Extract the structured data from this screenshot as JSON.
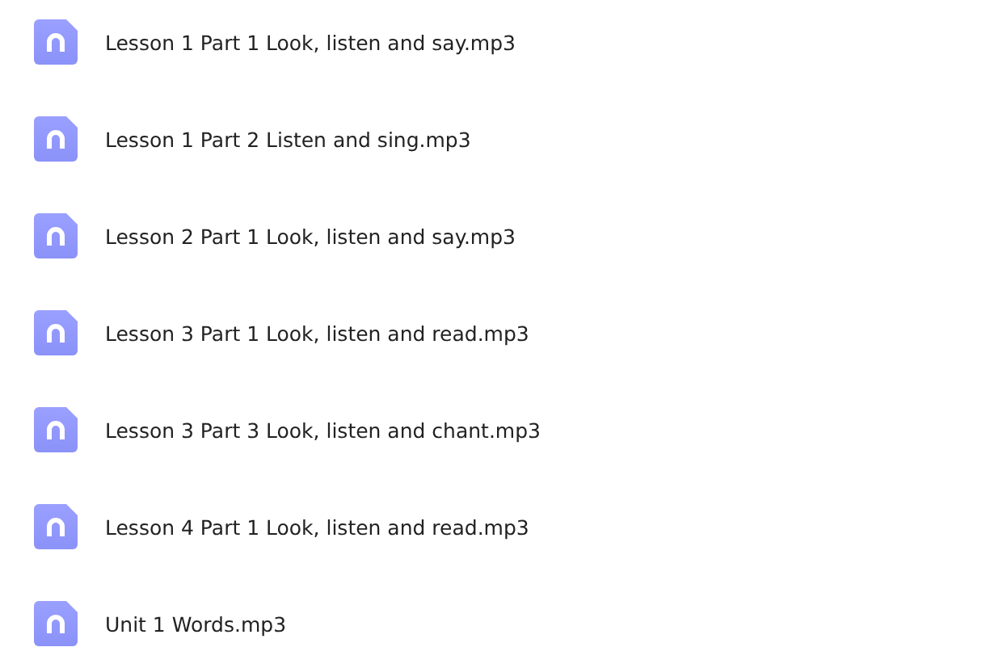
{
  "files": [
    {
      "name": "Lesson 1 Part 1 Look, listen and say.mp3"
    },
    {
      "name": "Lesson 1 Part 2 Listen and sing.mp3"
    },
    {
      "name": "Lesson 2 Part 1 Look, listen and say.mp3"
    },
    {
      "name": "Lesson 3 Part 1 Look, listen and read.mp3"
    },
    {
      "name": "Lesson 3 Part 3 Look, listen and chant.mp3"
    },
    {
      "name": "Lesson 4 Part 1 Look, listen and read.mp3"
    },
    {
      "name": "Unit 1 Words.mp3"
    }
  ]
}
